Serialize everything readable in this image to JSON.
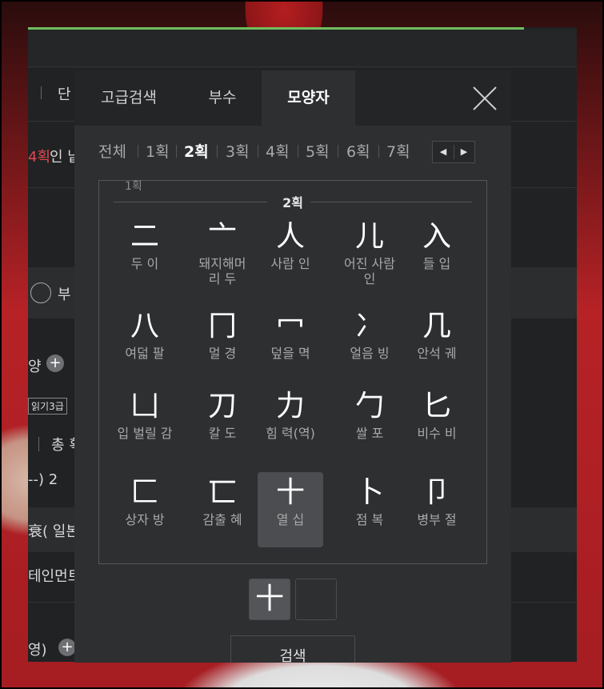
{
  "background_panel": {
    "snippets": [
      "단",
      "4획",
      "인 낱",
      "부",
      "양",
      "읽기3급",
      "총 획",
      "--)  2",
      "衰( 일본",
      "테인먼트",
      "영)"
    ]
  },
  "modal": {
    "tabs": [
      "고급검색",
      "부수",
      "모양자"
    ],
    "active_tab": "모양자",
    "stroke_filters": [
      "전체",
      "1획",
      "2획",
      "3획",
      "4획",
      "5획",
      "6획",
      "7획"
    ],
    "active_stroke": "2획",
    "pager": {
      "prev": "◀",
      "next": "▶"
    },
    "partial_group_label": "1획",
    "group_label": "2획",
    "radicals": [
      {
        "char": "二",
        "name": "두 이"
      },
      {
        "char": "亠",
        "name": "돼지해머\n리 두"
      },
      {
        "char": "人",
        "name": "사람 인"
      },
      {
        "char": "儿",
        "name": "어진 사람\n인"
      },
      {
        "char": "入",
        "name": "들 입"
      },
      {
        "char": "八",
        "name": "여덟 팔"
      },
      {
        "char": "冂",
        "name": "멀 경"
      },
      {
        "char": "冖",
        "name": "덮을 멱"
      },
      {
        "char": "冫",
        "name": "얼음 빙"
      },
      {
        "char": "几",
        "name": "안석 궤"
      },
      {
        "char": "凵",
        "name": "입 벌릴 감"
      },
      {
        "char": "刀",
        "name": "칼 도"
      },
      {
        "char": "力",
        "name": "힘 력(역)"
      },
      {
        "char": "勹",
        "name": "쌀 포"
      },
      {
        "char": "匕",
        "name": "비수 비"
      },
      {
        "char": "匚",
        "name": "상자 방"
      },
      {
        "char": "匸",
        "name": "감출 혜"
      },
      {
        "char": "十",
        "name": "열 십"
      },
      {
        "char": "卜",
        "name": "점 복"
      },
      {
        "char": "卩",
        "name": "병부 절"
      }
    ],
    "selected_radical": "十",
    "selected_slots": [
      "十",
      ""
    ],
    "search_label": "검색"
  },
  "colors": {
    "accent_bar": "#6fbf5e",
    "highlight_red": "#e2474f",
    "modal_bg": "#2d2f31",
    "selected_cell": "#4b4d50"
  },
  "icons": {
    "close": "close-icon",
    "prev": "triangle-left-icon",
    "next": "triangle-right-icon",
    "plus": "plus-icon"
  }
}
